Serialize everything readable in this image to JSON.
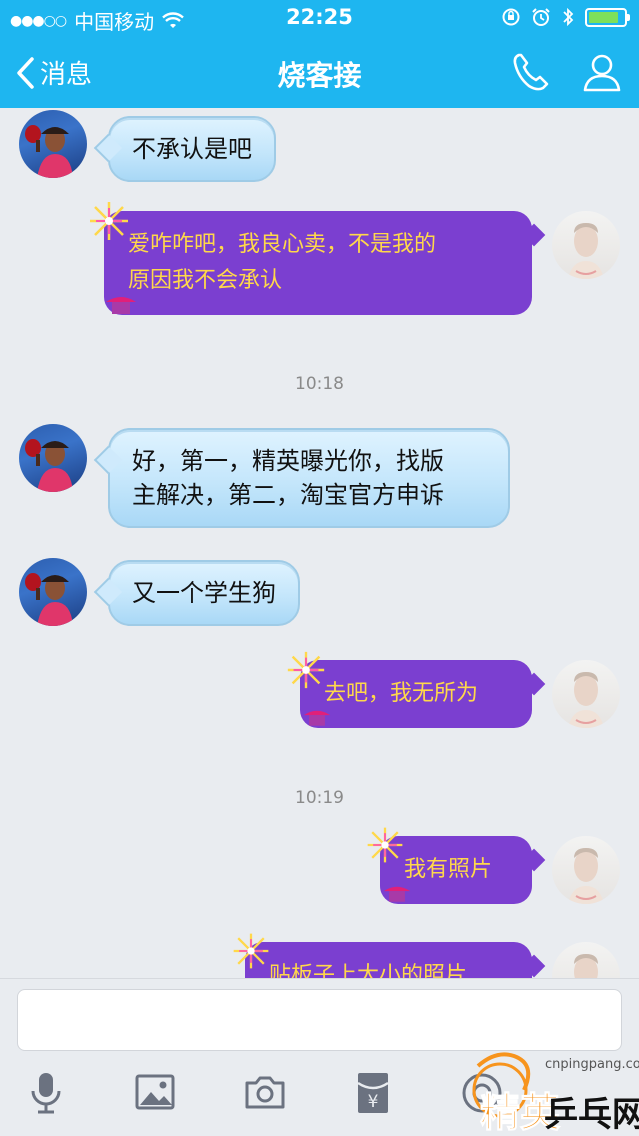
{
  "status_bar": {
    "signal_dots": "●●●○○",
    "carrier": "中国移动",
    "time": "22:25",
    "battery_level": 0.85
  },
  "nav": {
    "back_label": "消息",
    "title": "烧客接",
    "icons": [
      "phone-icon",
      "profile-icon",
      "back-chevron-icon"
    ]
  },
  "messages": [
    {
      "side": "left",
      "style": "blue",
      "text": "不承认是吧"
    },
    {
      "side": "right",
      "style": "purple",
      "line1": "爱咋咋吧，我良心卖，不是我的",
      "line2": "原因我不会承认"
    },
    {
      "type": "time",
      "text": "10:18"
    },
    {
      "side": "left",
      "style": "blue",
      "line1": "好，第一，精英曝光你，找版",
      "line2": "主解决，第二，淘宝官方申诉"
    },
    {
      "side": "left",
      "style": "blue",
      "text": "又一个学生狗"
    },
    {
      "side": "right",
      "style": "purple",
      "text": "去吧，我无所为"
    },
    {
      "type": "time",
      "text": "10:19"
    },
    {
      "side": "right",
      "style": "purple",
      "text": "我有照片"
    },
    {
      "side": "right",
      "style": "purple",
      "text": "贴板子上大小的照片"
    }
  ],
  "input": {
    "placeholder": "",
    "tools": [
      "microphone-icon",
      "image-icon",
      "camera-icon",
      "red-packet-icon",
      "more-icon"
    ]
  },
  "watermark": {
    "site": "cnpingpang.com",
    "logo_text": "精英乒乓网"
  },
  "colors": {
    "nav_bg": "#1eb6f0",
    "chat_bg": "#e9ecf0",
    "purple_bubble": "#7b3fd0",
    "purple_text": "#ffd84a",
    "blue_bubble": "#c4e6fb"
  }
}
